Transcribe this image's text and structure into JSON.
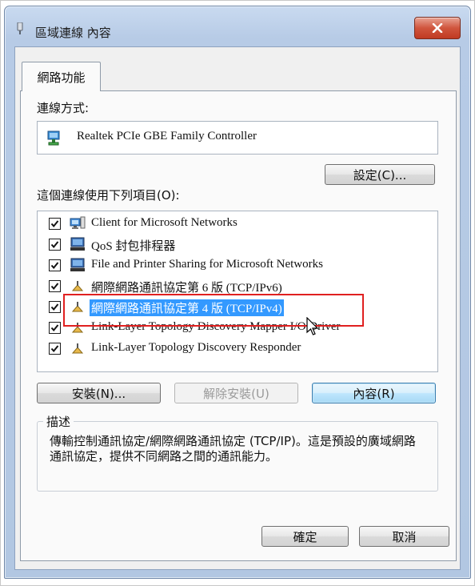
{
  "window": {
    "title": "區域連線 內容"
  },
  "tabs": [
    {
      "label": "網路功能"
    }
  ],
  "connect_using": {
    "label": "連線方式:",
    "adapter_name": "Realtek PCIe GBE Family Controller",
    "configure_button": "設定(C)..."
  },
  "items_section": {
    "label": "這個連線使用下列項目(O):",
    "items": [
      {
        "label": "Client for Microsoft Networks",
        "checked": true,
        "icon": "network-client-icon"
      },
      {
        "label": "QoS 封包排程器",
        "checked": true,
        "icon": "computer-icon"
      },
      {
        "label": "File and Printer Sharing for Microsoft Networks",
        "checked": true,
        "icon": "computer-icon"
      },
      {
        "label": "網際網路通訊協定第 6 版 (TCP/IPv6)",
        "checked": true,
        "icon": "protocol-icon"
      },
      {
        "label": "網際網路通訊協定第 4 版 (TCP/IPv4)",
        "checked": true,
        "icon": "protocol-icon",
        "selected": true
      },
      {
        "label": "Link-Layer Topology Discovery Mapper I/O Driver",
        "checked": true,
        "icon": "protocol-icon"
      },
      {
        "label": "Link-Layer Topology Discovery Responder",
        "checked": true,
        "icon": "protocol-icon"
      }
    ]
  },
  "buttons": {
    "install": "安裝(N)...",
    "uninstall": "解除安裝(U)",
    "properties": "內容(R)",
    "ok": "確定",
    "cancel": "取消"
  },
  "description": {
    "title": "描述",
    "text": "傳輸控制通訊協定/網際網路通訊協定 (TCP/IP)。這是預設的廣域網路通訊協定，提供不同網路之間的通訊能力。"
  },
  "colors": {
    "selection": "#3399ff",
    "annotation_box": "#e02020"
  }
}
